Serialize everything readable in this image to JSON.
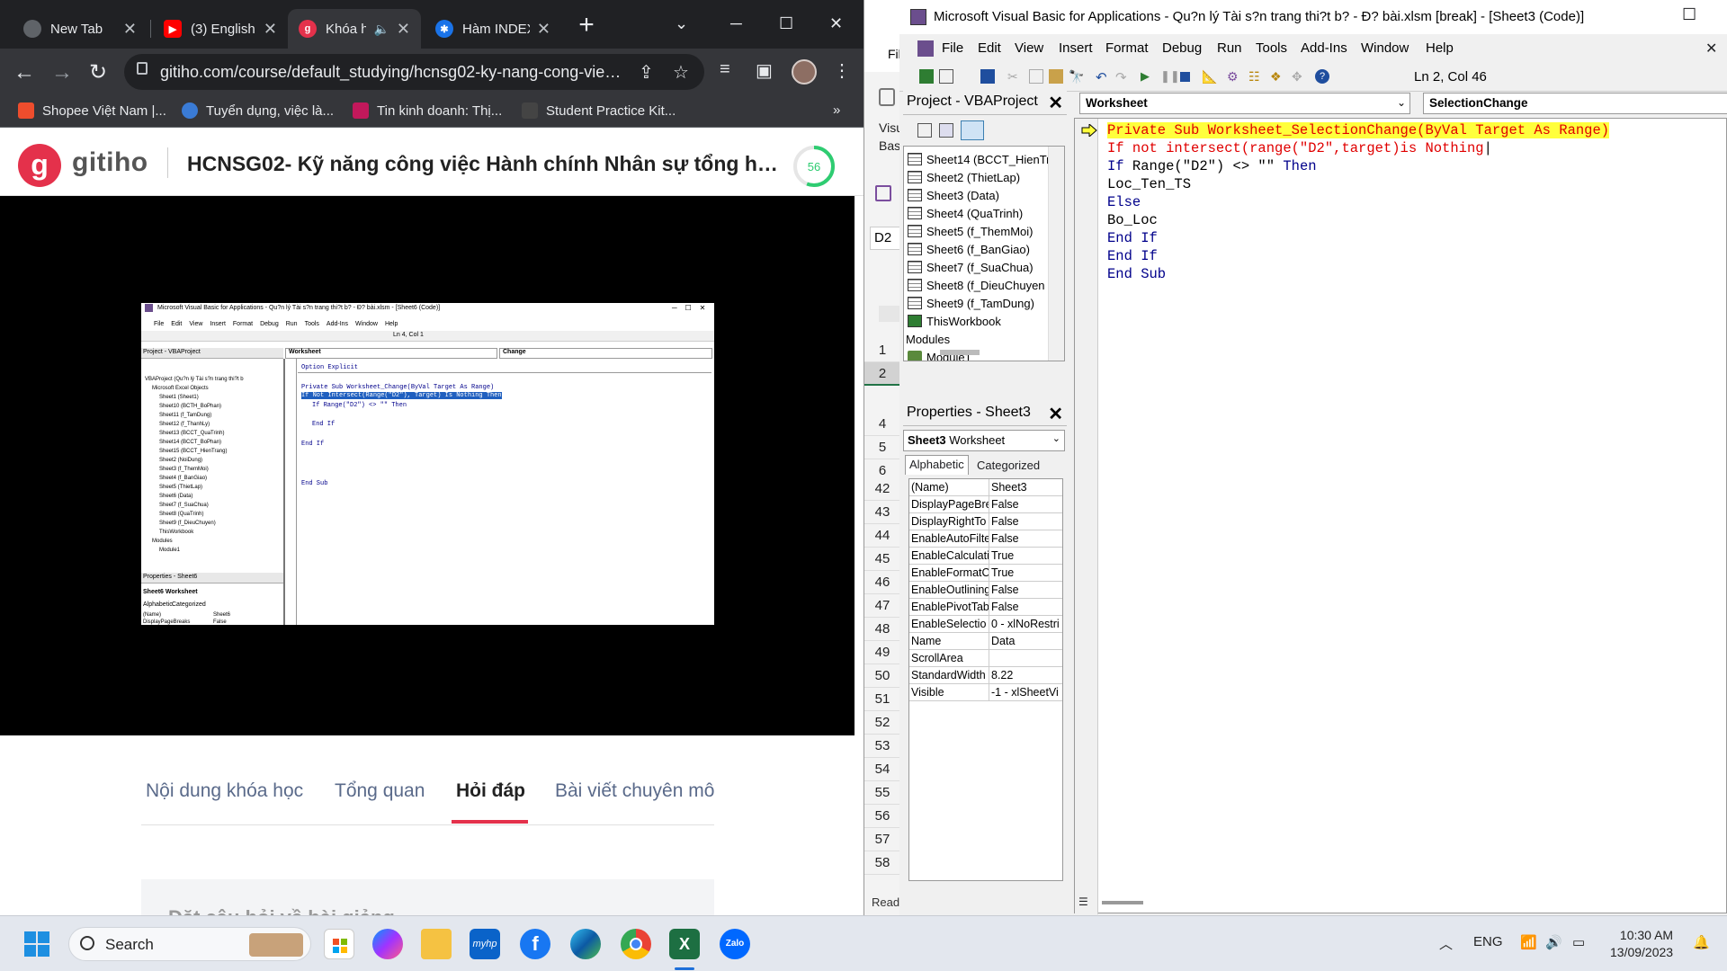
{
  "chrome": {
    "tabs": [
      {
        "title": "New Tab",
        "icon": "chrome-icon",
        "color": "#5f6368"
      },
      {
        "title": "(3) English",
        "icon": "youtube-icon",
        "color": "#ff0000"
      },
      {
        "title": "Khóa h",
        "icon": "gitiho-icon",
        "color": "#e4314b"
      },
      {
        "title": "Hàm INDEX",
        "icon": "web-icon",
        "color": "#1a73e8"
      }
    ],
    "url": "gitiho.com/course/default_studying/hcnsg02-ky-nang-cong-viec-...",
    "bookmarks": [
      {
        "label": "Shopee Việt Nam |...",
        "color": "#ee4d2d"
      },
      {
        "label": "Tuyển dụng, việc là...",
        "color": "#3a7bd5"
      },
      {
        "label": "Tin kinh doanh: Thị...",
        "color": "#c2185b"
      },
      {
        "label": "Student Practice Kit...",
        "color": "#444444"
      }
    ],
    "more_bookmarks": "»"
  },
  "site": {
    "logo_letter": "g",
    "logo_text": "gitiho",
    "course_title": "HCNSG02- Kỹ năng công việc Hành chính Nhân sự tổng hợ...",
    "progress": "56",
    "progress_fraction": 0.56,
    "tabs": [
      "Nội dung khóa học",
      "Tổng quan",
      "Hỏi đáp",
      "Bài viết chuyên mô"
    ],
    "active_tab": "Hỏi đáp",
    "question_placeholder": "Đặt câu hỏi về bài giảng"
  },
  "video_thumb": {
    "title": "Microsoft Visual Basic for Applications - Qu?n lý Tài s?n trang thi?t b? - Ð? bài.xlsm - [Sheet6 (Code)]",
    "menu": [
      "File",
      "Edit",
      "View",
      "Insert",
      "Format",
      "Debug",
      "Run",
      "Tools",
      "Add-Ins",
      "Window",
      "Help"
    ],
    "lncol": "Ln 4, Col 1",
    "project_label": "Project - VBAProject",
    "combo_left": "Worksheet",
    "combo_right": "Change",
    "tree": [
      "VBAProject (Qu?n lý Tài s?n trang thi?t b",
      "Microsoft Excel Objects",
      "Sheet1 (Sheet1)",
      "Sheet10 (BCTH_BoPhan)",
      "Sheet11 (f_TamDung)",
      "Sheet12 (f_ThanhLy)",
      "Sheet13 (BCCT_QuaTrinh)",
      "Sheet14 (BCCT_BoPhan)",
      "Sheet15 (BCCT_HienTrang)",
      "Sheet2 (NoiDung)",
      "Sheet3 (f_ThemMoi)",
      "Sheet4 (f_BanGiao)",
      "Sheet5 (ThietLap)",
      "Sheet6 (Data)",
      "Sheet7 (f_SuaChua)",
      "Sheet8 (QuaTrinh)",
      "Sheet9 (f_DieuChuyen)",
      "ThisWorkbook",
      "Modules",
      "Module1"
    ],
    "props_label": "Properties - Sheet6",
    "props_sel": "Sheet6 Worksheet",
    "props_tabs": [
      "Alphabetic",
      "Categorized"
    ],
    "props_rows": [
      [
        "(Name)",
        "Sheet6"
      ],
      [
        "DisplayPageBreaks",
        "False"
      ]
    ],
    "code": [
      "Option Explicit",
      "Private Sub Worksheet_Change(ByVal Target As Range)",
      "If Not Intersect(Range(\"D2\"), Target) Is Nothing Then",
      "If Range(\"D2\") <> \"\" Then",
      "End If",
      "End If",
      "End Sub"
    ]
  },
  "excel": {
    "file_label": "Fil",
    "visual_label": "Visu",
    "basic_label": "Bas",
    "namebox": "D2",
    "rows": [
      "1",
      "2",
      "4",
      "5",
      "6",
      "42",
      "43",
      "44",
      "45",
      "46",
      "47",
      "48",
      "49",
      "50",
      "51",
      "52",
      "53",
      "54",
      "55",
      "56",
      "57",
      "58"
    ],
    "status": "Ready"
  },
  "vba": {
    "title": "Microsoft Visual Basic for Applications - Qu?n lý Tài s?n trang thi?t b? - Ð? bài.xlsm [break] - [Sheet3 (Code)]",
    "menu": [
      "File",
      "Edit",
      "View",
      "Insert",
      "Format",
      "Debug",
      "Run",
      "Tools",
      "Add-Ins",
      "Window",
      "Help"
    ],
    "lncol": "Ln 2, Col 46",
    "project_pane": "Project - VBAProject",
    "project_items": [
      "Sheet14 (BCCT_HienTr",
      "Sheet2 (ThietLap)",
      "Sheet3 (Data)",
      "Sheet4 (QuaTrinh)",
      "Sheet5 (f_ThemMoi)",
      "Sheet6 (f_BanGiao)",
      "Sheet7 (f_SuaChua)",
      "Sheet8 (f_DieuChuyen",
      "Sheet9 (f_TamDung)",
      "ThisWorkbook"
    ],
    "modules_label": "Modules",
    "module_items": [
      "Module1"
    ],
    "properties_pane": "Properties - Sheet3",
    "props_object": "Sheet3",
    "props_type": "Worksheet",
    "props_tabs": [
      "Alphabetic",
      "Categorized"
    ],
    "props": [
      [
        "(Name)",
        "Sheet3"
      ],
      [
        "DisplayPageBre",
        "False"
      ],
      [
        "DisplayRightTo",
        "False"
      ],
      [
        "EnableAutoFilte",
        "False"
      ],
      [
        "EnableCalculati",
        "True"
      ],
      [
        "EnableFormatC",
        "True"
      ],
      [
        "EnableOutlining",
        "False"
      ],
      [
        "EnablePivotTab",
        "False"
      ],
      [
        "EnableSelectio",
        "0 - xlNoRestri"
      ],
      [
        "Name",
        "Data"
      ],
      [
        "ScrollArea",
        ""
      ],
      [
        "StandardWidth",
        "8.22"
      ],
      [
        "Visible",
        "-1 - xlSheetVi"
      ]
    ],
    "object_combo": "Worksheet",
    "proc_combo": "SelectionChange",
    "code": {
      "l1": "Private Sub Worksheet_SelectionChange(ByVal Target As Range)",
      "l2": "If not intersect(range(\"D2\",target)is Nothing",
      "l3_kw1": "If",
      "l3_mid": " Range(\"D2\") <> \"\" ",
      "l3_kw2": "Then",
      "l4": "Loc_Ten_TS",
      "l5": "Else",
      "l6": "Bo_Loc",
      "l7": "End If",
      "l8": "End If",
      "l9": "End Sub"
    },
    "colors": {
      "highlight": "#ffff3c",
      "error": "#e00000",
      "keyword": "#00008b"
    }
  },
  "taskbar": {
    "search": "Search",
    "lang": "ENG",
    "time": "10:30 AM",
    "date": "13/09/2023",
    "apps": [
      "windows-start-icon",
      "store-icon",
      "messenger-icon",
      "file-explorer-icon",
      "myhp-icon",
      "facebook-icon",
      "edge-icon",
      "chrome-icon",
      "excel-icon",
      "zalo-icon"
    ],
    "myhp": "myhp",
    "zalo": "Zalo"
  }
}
